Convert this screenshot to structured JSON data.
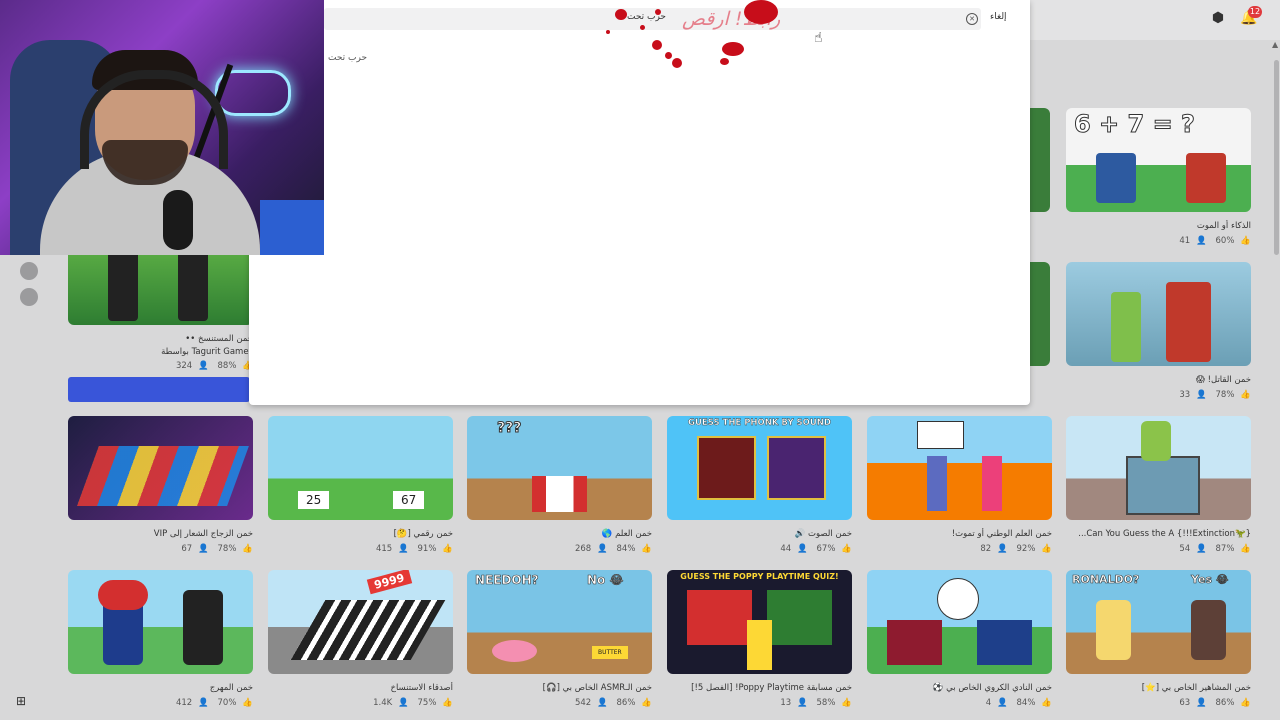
{
  "search": {
    "query": "حرب تحت",
    "cancel_label": "إلغاء",
    "suggestion": "حرب تحت"
  },
  "notifications": {
    "count": "12"
  },
  "overlay_text": "رابط! ارقص",
  "featured_left": {
    "title": "خمن المستنسخ ••",
    "by": "Tagurit Games بواسطة",
    "likes": "88%",
    "players": "324"
  },
  "right_col": [
    {
      "title": "الذكاء أو الموت",
      "likes": "60%",
      "players": "41"
    },
    {
      "title": "خمن القاتل! 😱",
      "likes": "78%",
      "players": "33"
    }
  ],
  "row1": [
    {
      "title": "خمن الزجاج الشعار إلى VIP",
      "likes": "78%",
      "players": "67"
    },
    {
      "title": "خمن رقمي [🤔]",
      "likes": "91%",
      "players": "415"
    },
    {
      "title": "خمن العلم 🌎",
      "likes": "84%",
      "players": "268"
    },
    {
      "title": "خمن الصوت 🔊",
      "likes": "67%",
      "players": "44"
    },
    {
      "title": "خمن العلم الوطني أو تموت!",
      "likes": "92%",
      "players": "82"
    },
    {
      "title": "{🦖Extinction!!!} Can You Guess the A...",
      "likes": "87%",
      "players": "54"
    }
  ],
  "row2": [
    {
      "title": "خمن المهرج",
      "likes": "70%",
      "players": "412"
    },
    {
      "title": "أصدقاء الاستنساخ",
      "likes": "75%",
      "players": "1.4K"
    },
    {
      "title": "خمن الـASMR الخاص بي [🎧]",
      "likes": "86%",
      "players": "542"
    },
    {
      "title": "خمن مسابقة Poppy Playtime! [الفصل 5!]",
      "likes": "58%",
      "players": "13"
    },
    {
      "title": "خمن النادي الكروي الخاص بي ⚽",
      "likes": "84%",
      "players": "4"
    },
    {
      "title": "خمن المشاهير الخاص بي [⭐]",
      "likes": "86%",
      "players": "63"
    }
  ],
  "thumb_text": {
    "math": "6 + 7 = ?",
    "flag_q": "???",
    "phonk": "GUESS THE PHONK BY SOUND",
    "numbers_a": "25",
    "numbers_b": "67",
    "needoh": "NEEDOH?",
    "no": "No 😂",
    "poppy": "GUESS THE POPPY PLAYTIME QUIZ!",
    "ronaldo": "RONALDO?",
    "yes": "Yes 😂",
    "butter": "BUTTER",
    "nines": "9999"
  }
}
